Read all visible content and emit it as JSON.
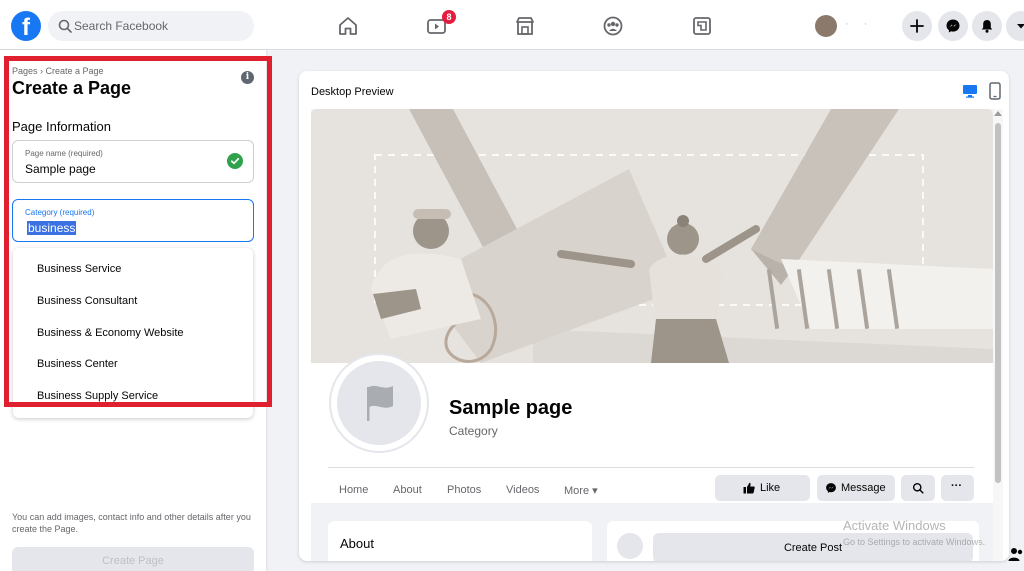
{
  "topbar": {
    "logo_letter": "f",
    "search_placeholder": "Search Facebook",
    "watch_badge": "8",
    "icons": [
      "home-icon",
      "watch-icon",
      "marketplace-icon",
      "groups-icon",
      "gaming-icon",
      "plus-icon",
      "messenger-icon",
      "notifications-icon",
      "account-menu-icon"
    ],
    "user_name": "· ·"
  },
  "left_panel": {
    "breadcrumb": "Pages › Create a Page",
    "title": "Create a Page",
    "section_title": "Page Information",
    "page_name_field": {
      "label": "Page name (required)",
      "value": "Sample page"
    },
    "category_field": {
      "label": "Category (required)",
      "value": "business"
    },
    "category_options": [
      "Business Service",
      "Business Consultant",
      "Business & Economy Website",
      "Business Center",
      "Business Supply Service"
    ],
    "help_text": "You can add images, contact info and other details after you create the Page.",
    "create_button": "Create Page"
  },
  "preview": {
    "label": "Desktop Preview",
    "page_name": "Sample page",
    "category": "Category",
    "tabs": [
      "Home",
      "About",
      "Photos",
      "Videos",
      "More ▾"
    ],
    "like_button": "Like",
    "message_button": "Message",
    "more_button": "···",
    "about_title": "About",
    "create_post": "Create Post"
  },
  "watermark": {
    "line1": "Activate Windows",
    "line2": "Go to Settings to activate Windows."
  },
  "colors": {
    "brand": "#1877f2",
    "highlight_border": "#e0202e",
    "success": "#31a24c"
  }
}
